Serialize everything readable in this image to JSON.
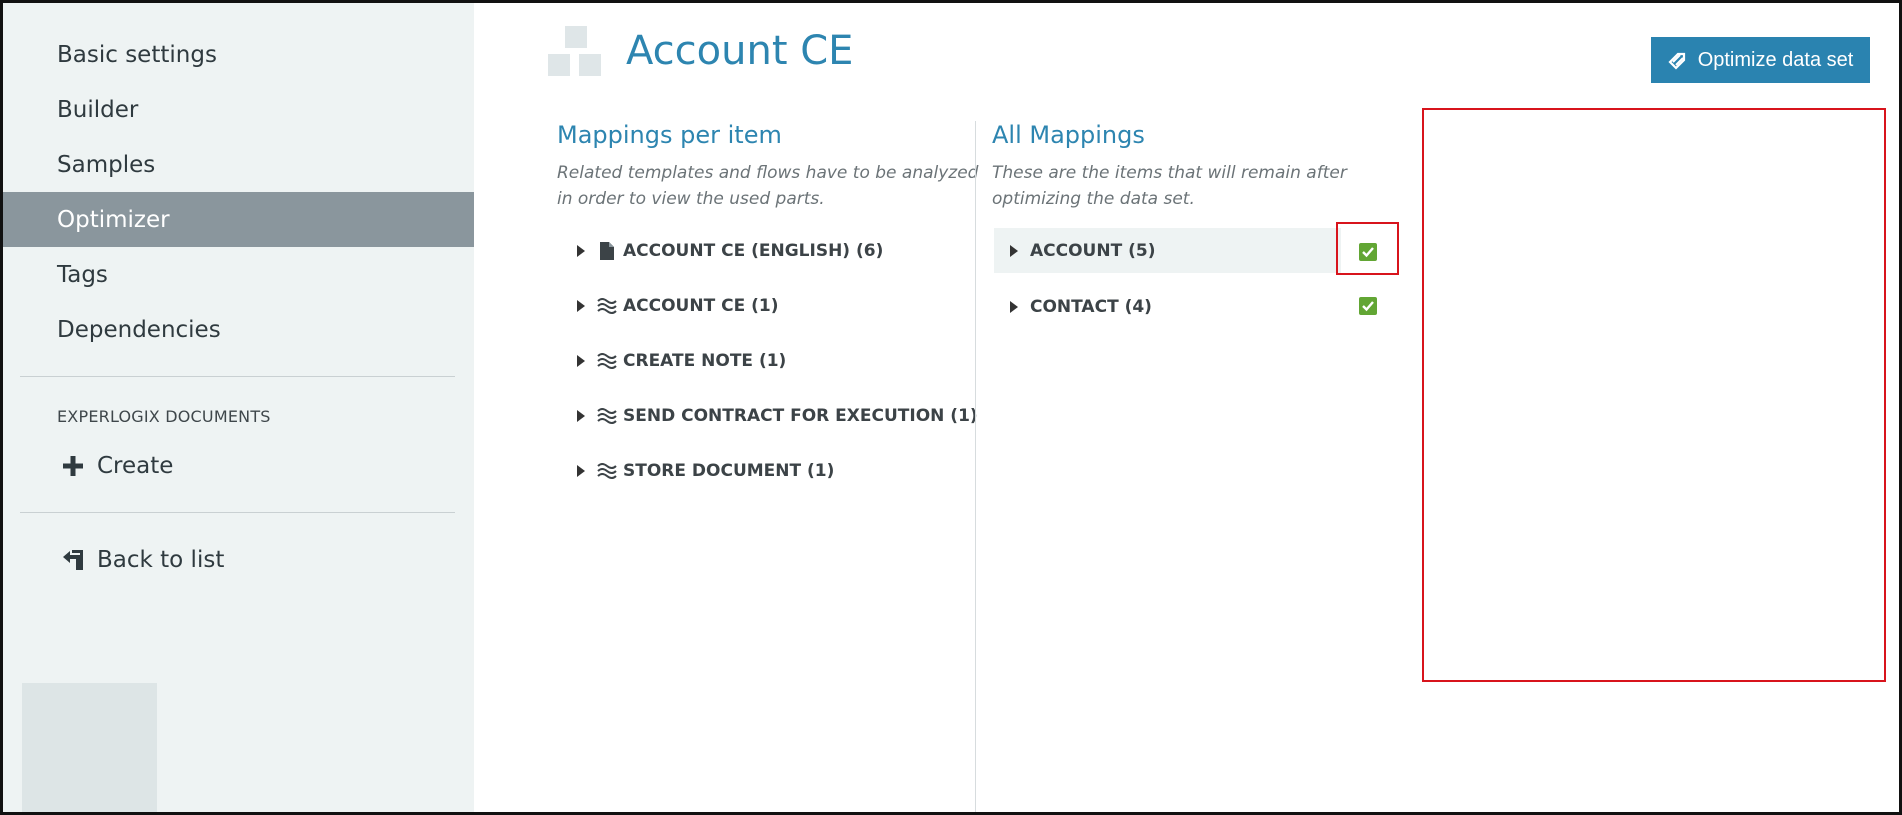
{
  "sidebar": {
    "items": [
      {
        "label": "Basic settings"
      },
      {
        "label": "Builder"
      },
      {
        "label": "Samples"
      },
      {
        "label": "Optimizer"
      },
      {
        "label": "Tags"
      },
      {
        "label": "Dependencies"
      }
    ],
    "section_label": "EXPERLOGIX DOCUMENTS",
    "create_label": "Create",
    "back_label": "Back to list"
  },
  "header": {
    "title": "Account CE",
    "optimize_button": "Optimize data set"
  },
  "mappings_per_item": {
    "title": "Mappings per item",
    "description_line1": "Related templates and flows have to be analyzed",
    "description_line2": "in order to view the used parts.",
    "items": [
      {
        "icon": "document-icon",
        "label": "ACCOUNT CE (ENGLISH) (6)"
      },
      {
        "icon": "flow-icon",
        "label": "ACCOUNT CE (1)"
      },
      {
        "icon": "flow-icon",
        "label": "CREATE NOTE (1)"
      },
      {
        "icon": "flow-icon",
        "label": "SEND CONTRACT FOR EXECUTION (1)"
      },
      {
        "icon": "flow-icon",
        "label": "STORE DOCUMENT (1)"
      }
    ]
  },
  "all_mappings": {
    "title": "All Mappings",
    "description_line1": "These are the items that will remain after",
    "description_line2": "optimizing the data set.",
    "items": [
      {
        "label": "ACCOUNT (5)",
        "checked": true
      },
      {
        "label": "CONTACT (4)",
        "checked": true
      }
    ]
  },
  "colors": {
    "accent": "#2d85b0",
    "button": "#2a83b0",
    "sidebar_bg": "#eef3f3",
    "active_nav": "#8a969d",
    "check": "#62a634",
    "highlight": "#d8141c"
  }
}
